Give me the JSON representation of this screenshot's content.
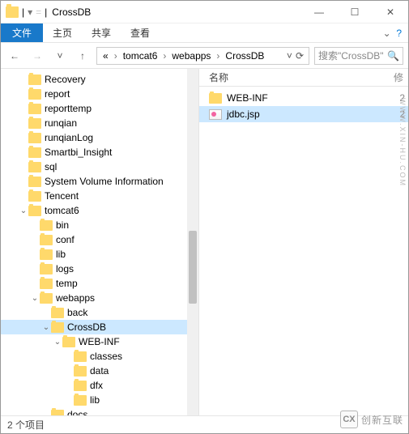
{
  "window": {
    "title": "CrossDB",
    "qat_sep": "|",
    "min": "—",
    "max": "☐",
    "close": "✕"
  },
  "menu": {
    "file": "文件",
    "home": "主页",
    "share": "共享",
    "view": "查看",
    "expand": "⌄",
    "help": "?"
  },
  "nav": {
    "back": "←",
    "fwd": "→",
    "down": "˅",
    "up": "↑",
    "refresh": "⟳",
    "dropdown": "˅"
  },
  "breadcrumb": {
    "ellipsis": "«",
    "segs": [
      "tomcat6",
      "webapps",
      "CrossDB"
    ],
    "chev": "›"
  },
  "search": {
    "placeholder": "搜索\"CrossDB\"",
    "icon": "🔍"
  },
  "tree": [
    {
      "indent": 1,
      "exp": "",
      "label": "Recovery"
    },
    {
      "indent": 1,
      "exp": "",
      "label": "report"
    },
    {
      "indent": 1,
      "exp": "",
      "label": "reporttemp"
    },
    {
      "indent": 1,
      "exp": "",
      "label": "runqian"
    },
    {
      "indent": 1,
      "exp": "",
      "label": "runqianLog"
    },
    {
      "indent": 1,
      "exp": "",
      "label": "Smartbi_Insight"
    },
    {
      "indent": 1,
      "exp": "",
      "label": "sql"
    },
    {
      "indent": 1,
      "exp": "",
      "label": "System Volume Information"
    },
    {
      "indent": 1,
      "exp": "",
      "label": "Tencent"
    },
    {
      "indent": 1,
      "exp": "⌄",
      "label": "tomcat6"
    },
    {
      "indent": 2,
      "exp": "",
      "label": "bin"
    },
    {
      "indent": 2,
      "exp": "",
      "label": "conf"
    },
    {
      "indent": 2,
      "exp": "",
      "label": "lib"
    },
    {
      "indent": 2,
      "exp": "",
      "label": "logs"
    },
    {
      "indent": 2,
      "exp": "",
      "label": "temp"
    },
    {
      "indent": 2,
      "exp": "⌄",
      "label": "webapps"
    },
    {
      "indent": 3,
      "exp": "",
      "label": "back"
    },
    {
      "indent": 3,
      "exp": "⌄",
      "label": "CrossDB",
      "selected": true
    },
    {
      "indent": 4,
      "exp": "⌄",
      "label": "WEB-INF"
    },
    {
      "indent": 5,
      "exp": "",
      "label": "classes"
    },
    {
      "indent": 5,
      "exp": "",
      "label": "data"
    },
    {
      "indent": 5,
      "exp": "",
      "label": "dfx"
    },
    {
      "indent": 5,
      "exp": "",
      "label": "lib"
    },
    {
      "indent": 3,
      "exp": "",
      "label": "docs"
    }
  ],
  "files": {
    "header_name": "名称",
    "header_mod": "修",
    "rows": [
      {
        "type": "folder",
        "name": "WEB-INF",
        "selected": false,
        "mod": "2"
      },
      {
        "type": "jsp",
        "name": "jdbc.jsp",
        "selected": true,
        "mod": "2"
      }
    ]
  },
  "status": {
    "text": "2 个项目"
  },
  "watermark": {
    "logo": "CX",
    "text": "创新互联",
    "side": "WWW.XIN-HU.COM"
  }
}
